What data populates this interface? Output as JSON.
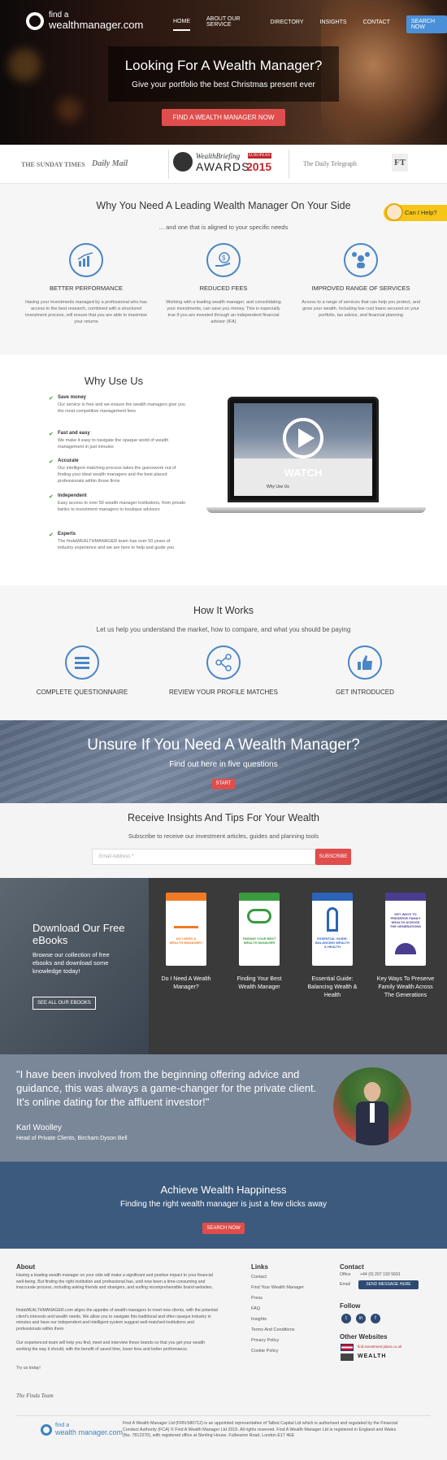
{
  "header": {
    "logo_line1": "find a",
    "logo_line2": "wealthmanager.com",
    "nav": [
      "HOME",
      "ABOUT OUR SERVICE",
      "DIRECTORY",
      "INSIGHTS",
      "CONTACT"
    ],
    "search_now": "SEARCH NOW"
  },
  "hero": {
    "title": "Looking For A Wealth Manager?",
    "subtitle": "Give your portfolio the best Christmas present ever",
    "button": "FIND A WEALTH MANAGER NOW"
  },
  "press": {
    "p1": "THE SUNDAY TIMES",
    "p2": "Daily Mail",
    "p3a": "WealthBriefing",
    "p3b": "EUROPEAN",
    "p3c": "AWARDS",
    "p3d": "2015",
    "p4": "The Daily Telegraph",
    "p5": "FT"
  },
  "why": {
    "title": "Why You Need A Leading Wealth Manager On Your Side",
    "subtitle": "... and one that is aligned to your specific needs",
    "help": "Can I Help?",
    "features": [
      {
        "title": "BETTER PERFORMANCE",
        "desc": "Having your investments managed by a professional who has access to the best research, combined with a structured investment process, will ensure that you are able to maximise your returns"
      },
      {
        "title": "REDUCED FEES",
        "desc": "Working with a leading wealth manager, and consolidating your investments, can save you money. This is especially true if you are invested through an independent financial advisor (IFA)"
      },
      {
        "title": "IMPROVED RANGE OF SERVICES",
        "desc": "Access to a range of services that can help you protect, and grow your wealth. Including low cost loans secured on your portfolio, tax advice, and financial planning"
      }
    ]
  },
  "wuu": {
    "title": "Why Use Us",
    "watch": "WATCH",
    "screen_caption": "Why Use Us",
    "items": [
      {
        "title": "Save money",
        "desc": "Our service is free and we ensure the wealth managers give you the most competitive management fees"
      },
      {
        "title": "Fast and easy",
        "desc": "We make it easy to navigate the opaque world of wealth management in just minutes"
      },
      {
        "title": "Accurate",
        "desc": "Our intelligent matching process takes the guesswork out of finding your ideal wealth managers and the best placed professionals within those firms"
      },
      {
        "title": "Independent",
        "desc": "Easy access to over 50 wealth manager institutions, from private banks to investment managers to boutique advisors"
      },
      {
        "title": "Experts",
        "desc": "The findaWEALTHMANAGER team has over 50 years of industry experience and we are here to help and guide you"
      }
    ]
  },
  "hiw": {
    "title": "How It Works",
    "subtitle": "Let us help you understand the market, how to compare, and what you should be paying",
    "steps": [
      "COMPLETE QUESTIONNAIRE",
      "REVIEW YOUR PROFILE MATCHES",
      "GET INTRODUCED"
    ]
  },
  "unsure": {
    "title": "Unsure If You Need A Wealth Manager?",
    "subtitle": "Find out here in five questions",
    "button": "START"
  },
  "insights": {
    "title": "Receive Insights And Tips For Your Wealth",
    "subtitle": "Subscribe to receive our investment articles, guides and planning tools",
    "placeholder": "Email Address *",
    "button": "SUBSCRIBE"
  },
  "ebooks": {
    "title": "Download Our Free eBooks",
    "desc": "Browse our collection of free ebooks and download some knowledge today!",
    "button": "SEE ALL OUR EBOOKS",
    "books": [
      {
        "title": "Do I Need A Wealth Manager?",
        "cover_text": "DO I NEED A WEALTH MANAGER?",
        "color": "#f07a26"
      },
      {
        "title": "Finding Your Best Wealth Manager",
        "cover_text": "FINDING YOUR BEST WEALTH MANAGER",
        "color": "#3a9a3e"
      },
      {
        "title": "Essential Guide: Balancing Wealth & Health",
        "cover_text": "ESSENTIAL GUIDE: BALANCING WEALTH & HEALTH",
        "color": "#2d63b8"
      },
      {
        "title": "Key Ways To Preserve Family Wealth Across The Generations",
        "cover_text": "KEY WAYS TO PRESERVE FAMILY WEALTH ACROSS THE GENERATIONS",
        "color": "#4a3d8f"
      }
    ]
  },
  "testimonial": {
    "quote": "\"I have been involved from the beginning offering advice and guidance, this was always a game-changer for the private client. It's online dating for the affluent investor!\"",
    "name": "Karl Woolley",
    "role": "Head of Private Clients, Bircham Dyson Bell"
  },
  "achieve": {
    "title": "Achieve Wealth Happiness",
    "subtitle": "Finding the right wealth manager is just a few clicks away",
    "button": "SEARCH NOW"
  },
  "footer": {
    "about_title": "About",
    "about_p1": "Having a leading wealth manager on your side will make a significant and positive impact to your financial well-being. But finding the right institution and professional has, until now been a time-consuming and inaccurate process, including asking friends and strangers, and surfing incomprehensible brand websites.",
    "about_p2": "findaWEALTHMANAGER.com aligns the appetite of wealth managers to meet new clients, with the potential client's interests and wealth needs. We allow you to navigate this traditional and often opaque industry in minutes and have our independent and intelligent system suggest well-matched institutions and professionals within them.",
    "about_p3": "Our experienced team will help you find, meet and interview these brands so that you get your wealth working the way it should, with the benefit of saved time, lower fees and better performance.",
    "about_p4": "Try us today!",
    "signature": "The Finda Team",
    "links_title": "Links",
    "links": [
      "Contact",
      "Find Your Wealth Manager",
      "Press",
      "FAQ",
      "Insights",
      "Terms And Conditions",
      "Privacy Policy",
      "Cookie Policy"
    ],
    "contact_title": "Contact",
    "office_label": "Office",
    "office_phone": "+44 (0) 207 193 5691",
    "email_label": "Email",
    "message_btn": "SEND MESSAGE HERE",
    "follow_title": "Follow",
    "other_title": "Other Websites",
    "other1": "find investment plans.co.uk",
    "other2": "WEALTH",
    "legal": "Find A Wealth Manager Ltd (FRN:580712) is an appointed representative of Talbot Capital Ltd which is authorised and regulated by the Financial Conduct Authority (FCA) © Find A Wealth Manager Ltd 2015. All rights reserved. Find A Wealth Manager Ltd is registered in England and Wales (No. 7812370), with registered office at Sterling House, Fulbourne Road, London E17 4EE",
    "logo_line1": "find a",
    "logo_line2": "wealth manager.com"
  },
  "colors": {
    "accent_blue": "#4a86c5",
    "cta_red": "#e04d4d",
    "navy": "#2d4a73",
    "help_yellow": "#f5c518"
  }
}
